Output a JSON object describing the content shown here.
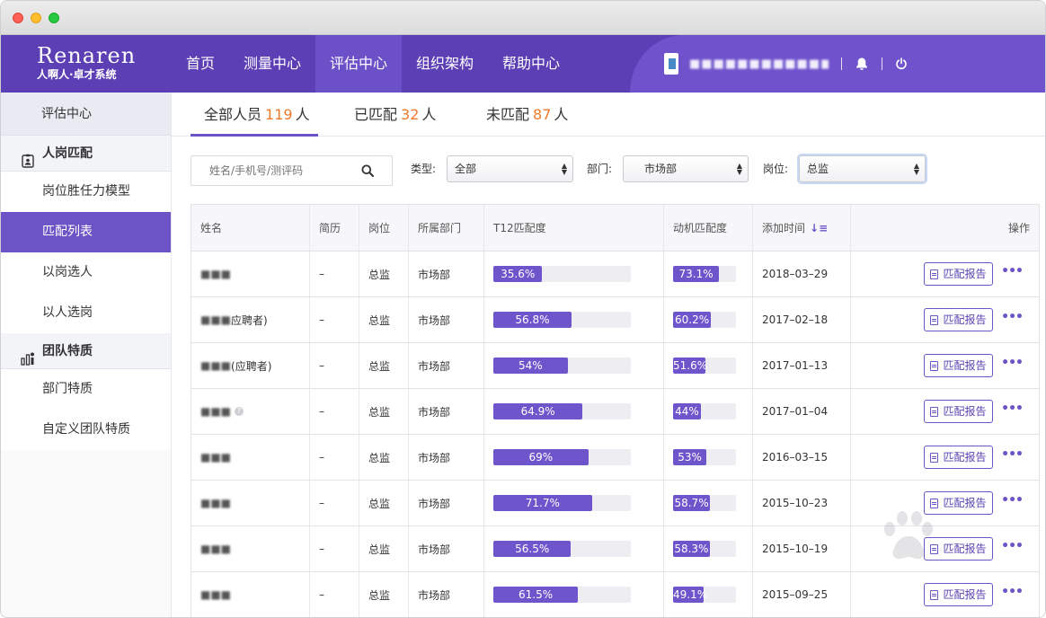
{
  "brand": {
    "name_en": "Renaren",
    "name_cn": "人啊人·卓才系统"
  },
  "nav": {
    "items": [
      {
        "label": "首页",
        "active": false
      },
      {
        "label": "测量中心",
        "active": false
      },
      {
        "label": "评估中心",
        "active": true
      },
      {
        "label": "组织架构",
        "active": false
      },
      {
        "label": "帮助中心",
        "active": false
      }
    ],
    "user_name": "(blurred)",
    "icons": [
      "bell-icon",
      "power-icon"
    ]
  },
  "sidebar": {
    "header": "评估中心",
    "groups": [
      {
        "label": "人岗匹配",
        "icon": "badge-icon",
        "items": [
          {
            "label": "岗位胜任力模型",
            "active": false
          },
          {
            "label": "匹配列表",
            "active": true
          },
          {
            "label": "以岗选人",
            "active": false
          },
          {
            "label": "以人选岗",
            "active": false
          }
        ]
      },
      {
        "label": "团队特质",
        "icon": "team-chart-icon",
        "items": [
          {
            "label": "部门特质",
            "active": false
          },
          {
            "label": "自定义团队特质",
            "active": false
          }
        ]
      }
    ]
  },
  "tabs": [
    {
      "label": "全部人员",
      "count": "119",
      "unit": "人",
      "active": true
    },
    {
      "label": "已匹配",
      "count": "32",
      "unit": "人",
      "active": false
    },
    {
      "label": "未匹配",
      "count": "87",
      "unit": "人",
      "active": false
    }
  ],
  "filters": {
    "search_placeholder": "姓名/手机号/测评码",
    "type_label": "类型:",
    "type_value": "全部",
    "dept_label": "部门:",
    "dept_value": "市场部",
    "post_label": "岗位:",
    "post_value": "总监"
  },
  "table": {
    "headers": {
      "name": "姓名",
      "resume": "简历",
      "position": "岗位",
      "department": "所属部门",
      "t12": "T12匹配度",
      "motive": "动机匹配度",
      "added": "添加时间",
      "ops": "操作"
    },
    "report_label": "匹配报告",
    "more_label": "•••",
    "rows": [
      {
        "name": "(blurred)",
        "suffix": "",
        "resume": "–",
        "position": "总监",
        "department": "市场部",
        "t12": "35.6%",
        "t12_value": 35.6,
        "motive": "73.1%",
        "motive_value": 73.1,
        "date": "2018–03–29"
      },
      {
        "name": "(blurred)",
        "suffix": "应聘者)",
        "resume": "–",
        "position": "总监",
        "department": "市场部",
        "t12": "56.8%",
        "t12_value": 56.8,
        "motive": "60.2%",
        "motive_value": 60.2,
        "date": "2017–02–18"
      },
      {
        "name": "(blurred)",
        "suffix": "(应聘者)",
        "resume": "–",
        "position": "总监",
        "department": "市场部",
        "t12": "54%",
        "t12_value": 54,
        "motive": "51.6%",
        "motive_value": 51.6,
        "date": "2017–01–13"
      },
      {
        "name": "(blurred)",
        "suffix": "",
        "resume": "–",
        "position": "总监",
        "department": "市场部",
        "t12": "64.9%",
        "t12_value": 64.9,
        "motive": "44%",
        "motive_value": 44,
        "date": "2017–01–04",
        "help_icon": true
      },
      {
        "name": "(blurred)",
        "suffix": "",
        "resume": "–",
        "position": "总监",
        "department": "市场部",
        "t12": "69%",
        "t12_value": 69,
        "motive": "53%",
        "motive_value": 53,
        "date": "2016–03–15"
      },
      {
        "name": "(blurred)",
        "suffix": "",
        "resume": "–",
        "position": "总监",
        "department": "市场部",
        "t12": "71.7%",
        "t12_value": 71.7,
        "motive": "58.7%",
        "motive_value": 58.7,
        "date": "2015–10–23"
      },
      {
        "name": "(blurred)",
        "suffix": "",
        "resume": "–",
        "position": "总监",
        "department": "市场部",
        "t12": "56.5%",
        "t12_value": 56.5,
        "motive": "58.3%",
        "motive_value": 58.3,
        "date": "2015–10–19"
      },
      {
        "name": "(blurred)",
        "suffix": "",
        "resume": "–",
        "position": "总监",
        "department": "市场部",
        "t12": "61.5%",
        "t12_value": 61.5,
        "motive": "49.1%",
        "motive_value": 49.1,
        "date": "2015–09–25"
      }
    ]
  },
  "colors": {
    "brand": "#5c3fb4",
    "accent": "#6c53c6",
    "count": "#f0782a"
  }
}
